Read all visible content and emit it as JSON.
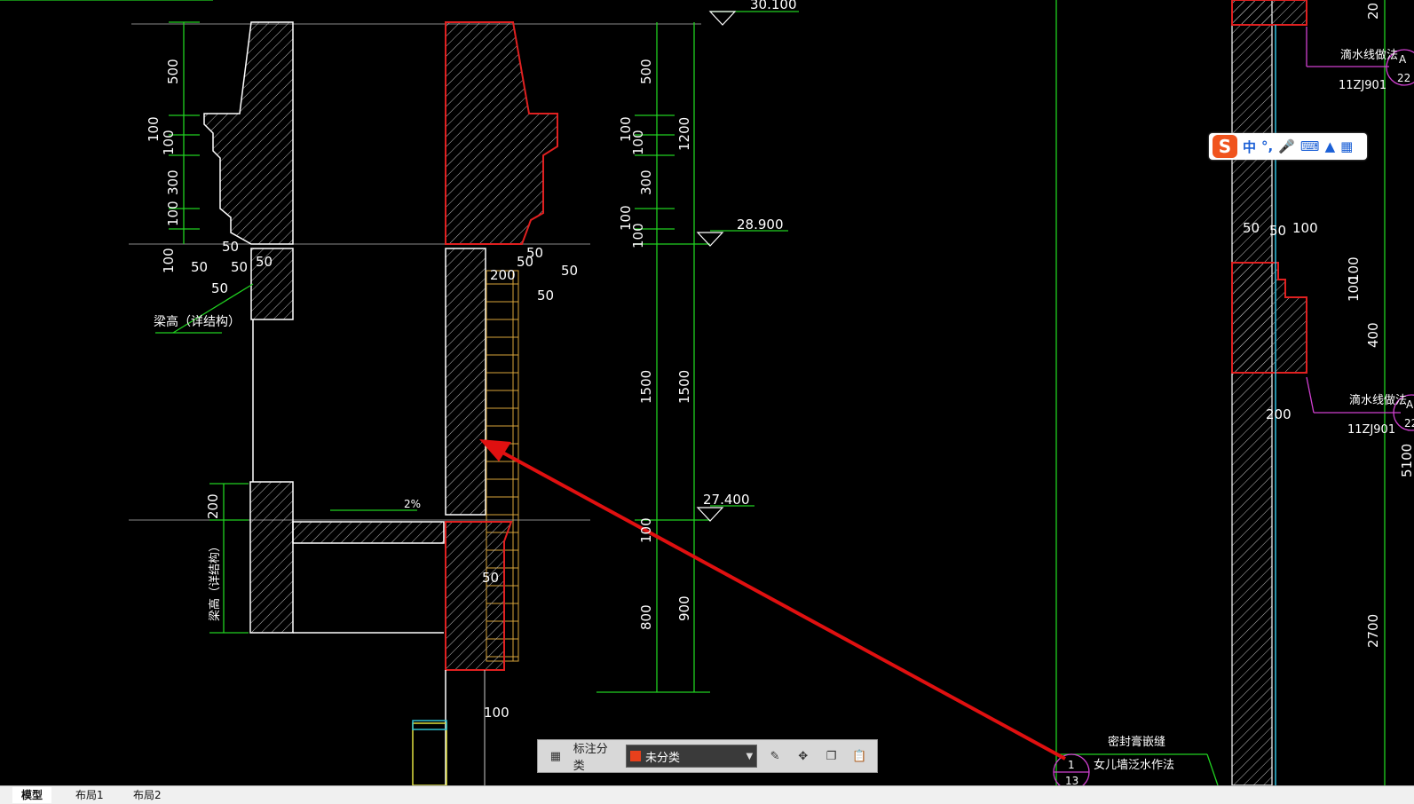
{
  "drawing": {
    "elevations": [
      "30.100",
      "28.900",
      "27.400"
    ],
    "left_dims": [
      "500",
      "100",
      "100",
      "300",
      "100",
      "100",
      "50",
      "50",
      "50",
      "50",
      "50",
      "200"
    ],
    "right_dims": [
      "500",
      "100",
      "100",
      "300",
      "100",
      "100",
      "1200",
      "1500",
      "1500",
      "100",
      "800",
      "900"
    ],
    "mid_dims": [
      "50",
      "50",
      "50",
      "50",
      "200",
      "50",
      "100"
    ],
    "labels": {
      "beam_height_1": "梁高（详结构）",
      "beam_height_2": "梁高（详结构）",
      "slope": "2%",
      "drip_line_1": "滴水线做法",
      "drip_line_2": "滴水线做法",
      "std_1": "11ZJ901",
      "std_2": "11ZJ901",
      "seal": "密封膏嵌缝",
      "parapet": "女儿墙泛水作法",
      "callout_a1_top": "A",
      "callout_a1_bottom": "22",
      "callout_a2_top": "A",
      "callout_a2_bottom": "22",
      "callout_b_top": "1",
      "callout_b_bottom": "13"
    },
    "far_right_dims": [
      "20",
      "50",
      "100",
      "100",
      "100",
      "400",
      "200",
      "5100",
      "2700",
      "50"
    ]
  },
  "ime": {
    "lang": "中",
    "punct": "°,",
    "mic": "mic-icon",
    "keyboard": "keyboard-icon",
    "skin": "shirt-icon",
    "menu": "grid-icon"
  },
  "anno_toolbar": {
    "label": "标注分类",
    "selected": "未分类",
    "swatch_color": "#e8401c"
  },
  "tabs": [
    "模型",
    "布局1",
    "布局2"
  ]
}
